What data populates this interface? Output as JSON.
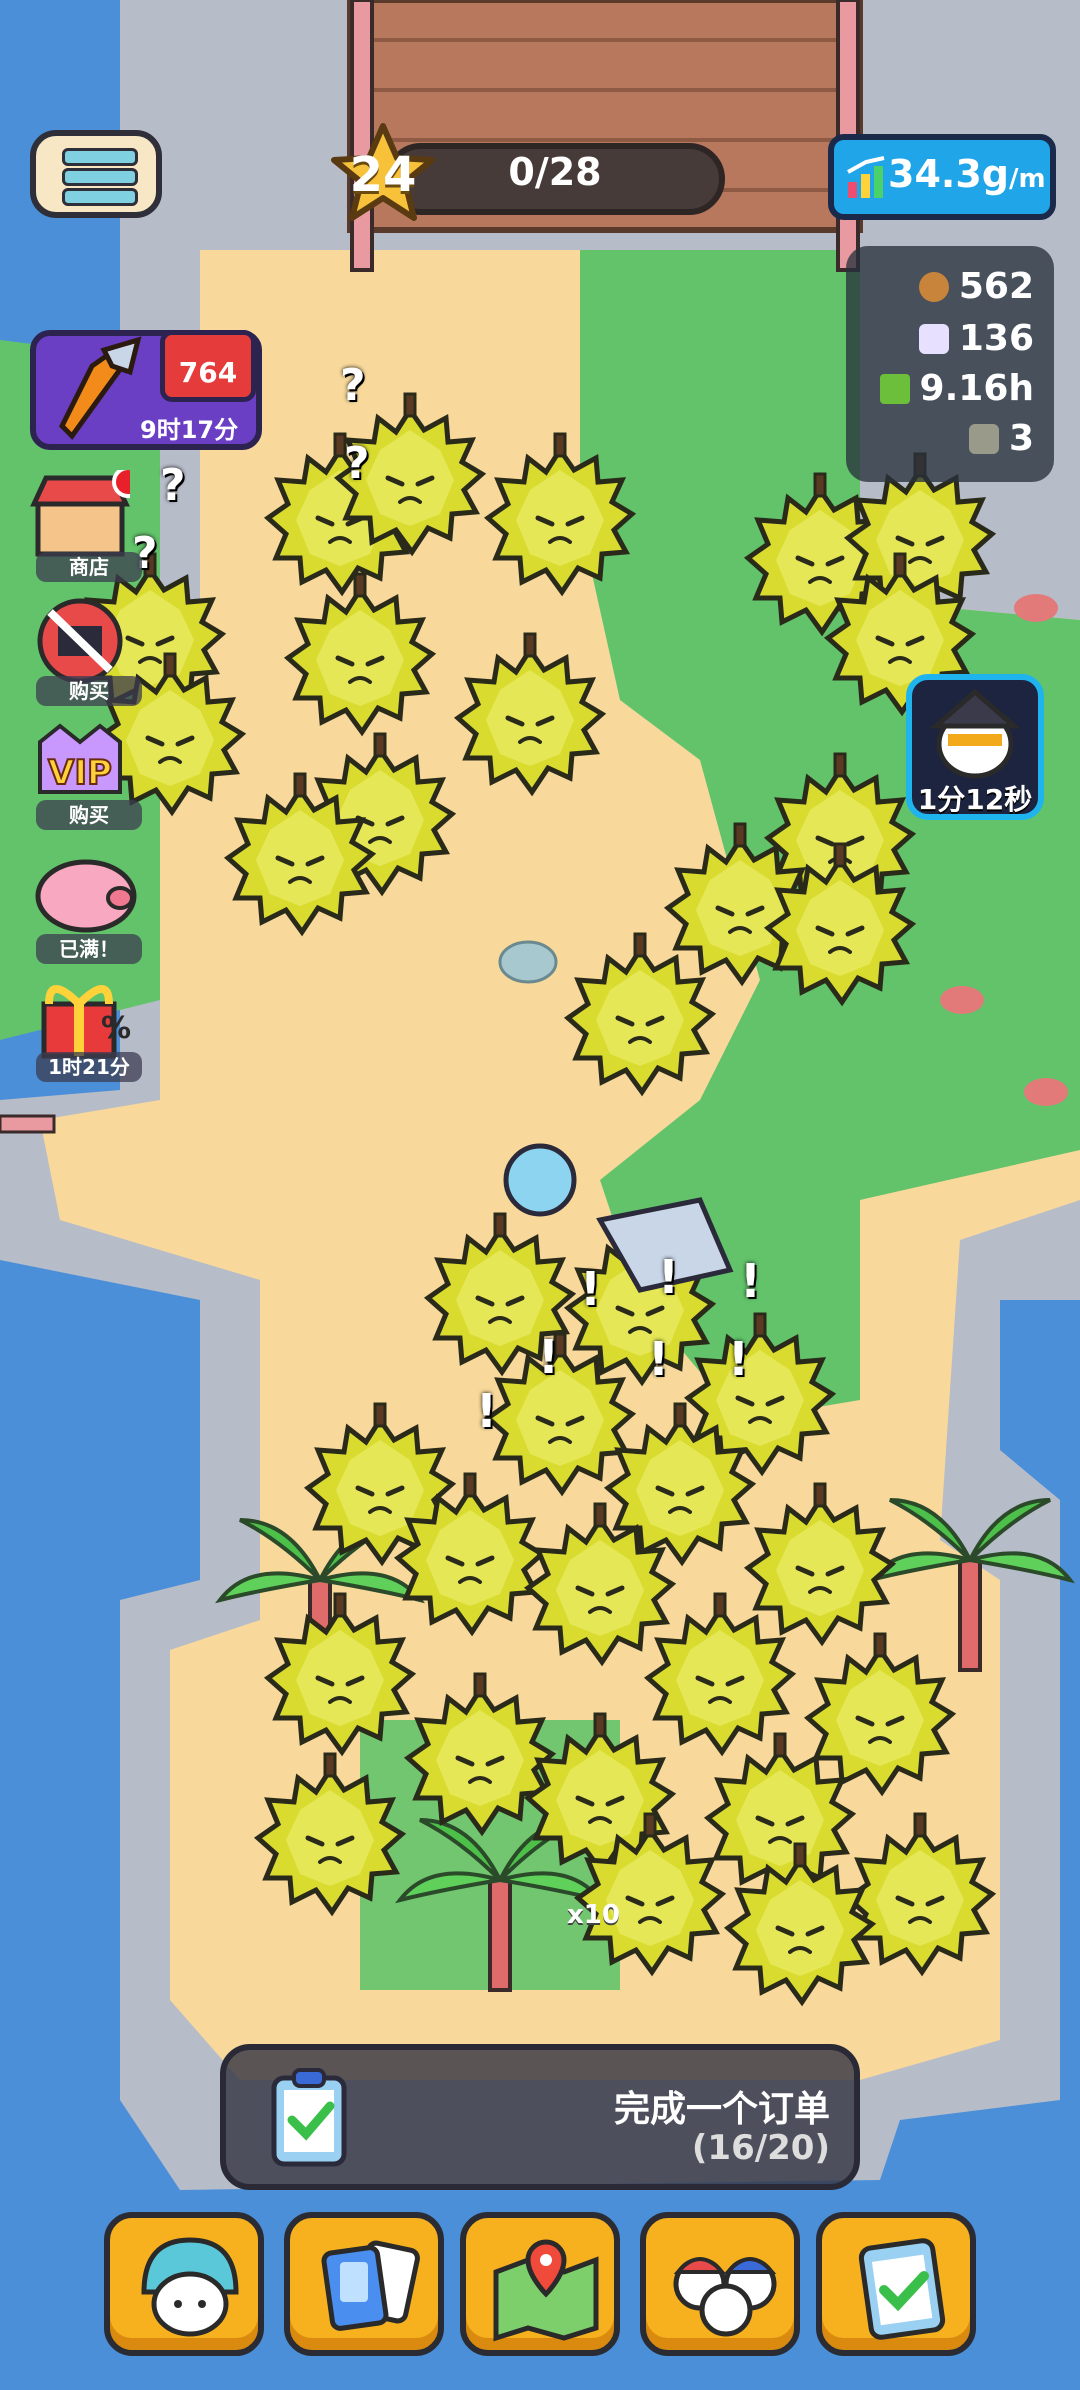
{
  "hud": {
    "level": "24",
    "level_progress": "0/28",
    "production_rate": "34.3g",
    "production_unit": "/m"
  },
  "resources": [
    {
      "name": "cookie-icon",
      "value": "562",
      "color": "#c7843a"
    },
    {
      "name": "gem-icon",
      "value": "136",
      "color": "#e8e0ff"
    },
    {
      "name": "cash-icon",
      "value": "9.16h",
      "color": "#6bbf3a"
    },
    {
      "name": "ore-icon",
      "value": "3",
      "color": "#9a9a8a"
    }
  ],
  "drill": {
    "trophy_value": "764",
    "timer": "9时17分"
  },
  "side_menu": [
    {
      "name": "shop",
      "label": "商店"
    },
    {
      "name": "no-ads",
      "label": "购买"
    },
    {
      "name": "vip",
      "label": "购买",
      "icon_text": "VIP"
    },
    {
      "name": "piggy-bank",
      "label": "已满！"
    },
    {
      "name": "gift-sale",
      "label": "1时21分",
      "icon_text": "%"
    }
  ],
  "bonus": {
    "timer": "1分12秒"
  },
  "multiplier": "x10",
  "quest": {
    "title": "完成一个订单",
    "progress": "(16/20)"
  },
  "bottom_nav": [
    {
      "name": "character"
    },
    {
      "name": "cards"
    },
    {
      "name": "map"
    },
    {
      "name": "team"
    },
    {
      "name": "tasks"
    }
  ],
  "colors": {
    "accent": "#f7b11e",
    "rate_box": "#1fa5e8",
    "durian": "#d6d82a"
  }
}
